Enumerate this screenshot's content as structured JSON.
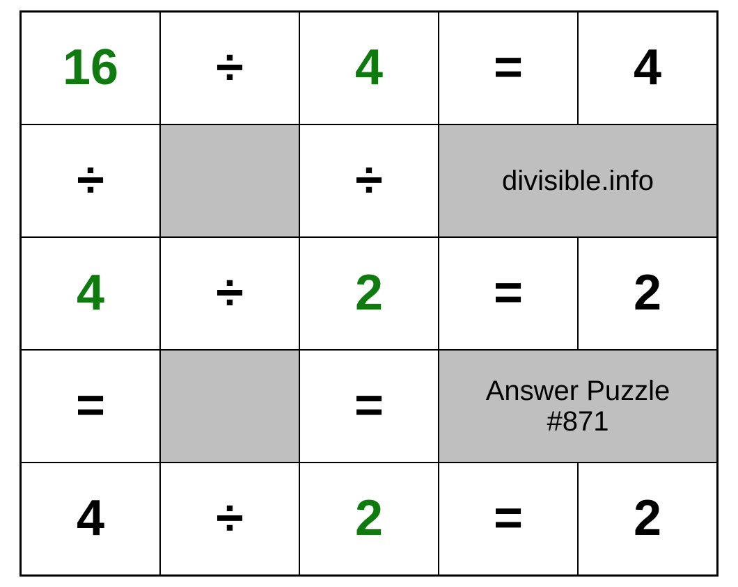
{
  "grid": {
    "r1": {
      "c1": "16",
      "c2": "÷",
      "c3": "4",
      "c4": "=",
      "c5": "4"
    },
    "r2": {
      "c1": "÷",
      "c3": "÷",
      "merged": "divisible.info"
    },
    "r3": {
      "c1": "4",
      "c2": "÷",
      "c3": "2",
      "c4": "=",
      "c5": "2"
    },
    "r4": {
      "c1": "=",
      "c3": "=",
      "merged": "Answer Puzzle\n#871"
    },
    "r5": {
      "c1": "4",
      "c2": "÷",
      "c3": "2",
      "c4": "=",
      "c5": "2"
    }
  },
  "colors": {
    "green": "#0f7b0f",
    "shaded": "#bfbfbf"
  }
}
